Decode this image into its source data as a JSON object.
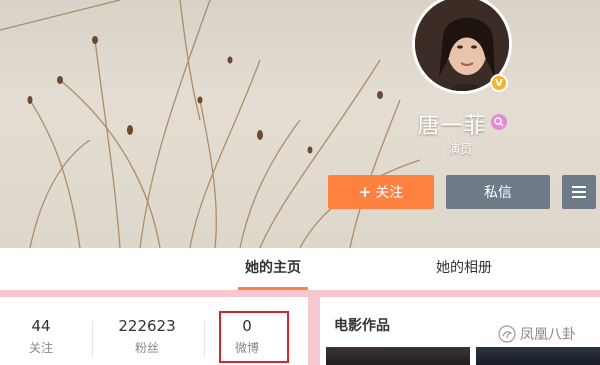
{
  "profile": {
    "name": "唐一菲",
    "title": "演员",
    "verified_badge": "V",
    "name_badge_icon": "search-icon"
  },
  "actions": {
    "follow_plus": "+",
    "follow_label": "关注",
    "message_label": "私信",
    "menu_icon": "menu-icon"
  },
  "tabs": [
    {
      "label": "她的主页",
      "active": true
    },
    {
      "label": "她的相册",
      "active": false
    }
  ],
  "stats": [
    {
      "value": "44",
      "label": "关注"
    },
    {
      "value": "222623",
      "label": "粉丝"
    },
    {
      "value": "0",
      "label": "微博"
    }
  ],
  "movies": {
    "title": "电影作品"
  },
  "watermark": {
    "text": "凤凰八卦"
  },
  "colors": {
    "accent": "#ff8140",
    "secondary_button": "#6f7a88",
    "highlight": "#d7262b",
    "verified": "#f3b230"
  }
}
